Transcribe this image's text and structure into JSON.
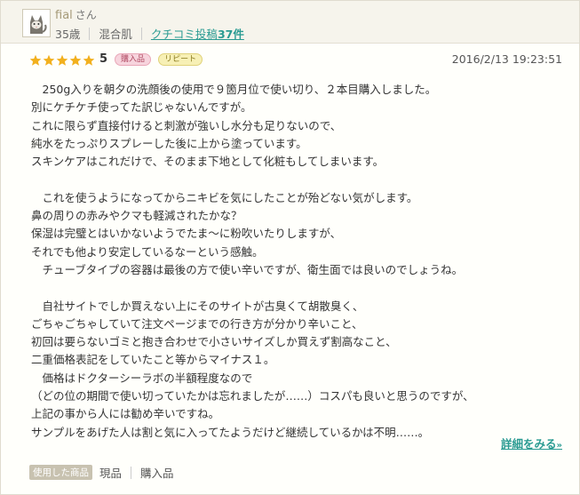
{
  "user": {
    "name": "fial",
    "suffix": "さん",
    "age": "35歳",
    "skin_type": "混合肌",
    "posts_label": "クチコミ投稿",
    "posts_count": "37件"
  },
  "review": {
    "rating": 5,
    "badges": [
      "購入品",
      "リピート"
    ],
    "timestamp": "2016/2/13 19:23:51",
    "lines": [
      "　250g入りを朝夕の洗顔後の使用で９箇月位で使い切り、２本目購入しました。",
      "別にケチケチ使ってた訳じゃないんですが。",
      "これに限らず直接付けると刺激が強いし水分も足りないので、",
      "純水をたっぷりスプレーした後に上から塗っています。",
      "スキンケアはこれだけで、そのまま下地として化粧もしてしまいます。",
      "",
      "　これを使うようになってからニキビを気にしたことが殆どない気がします。",
      "鼻の周りの赤みやクマも軽減されたかな？",
      "保湿は完璧とはいかないようでたま～に粉吹いたりしますが、",
      "それでも他より安定しているなーという感触。",
      "　チューブタイプの容器は最後の方で使い辛いですが、衛生面では良いのでしょうね。",
      "",
      "　自社サイトでしか買えない上にそのサイトが古臭くて胡散臭く、",
      "ごちゃごちゃしていて注文ページまでの行き方が分かり辛いこと、",
      "初回は要らないゴミと抱き合わせで小さいサイズしか買えず割高なこと、",
      "二重価格表記をしていたこと等からマイナス１。",
      "　価格はドクターシーラボの半額程度なので",
      "（どの位の期間で使い切っていたかは忘れましたが……）コスパも良いと思うのですが、",
      "上記の事から人には勧め辛いですね。",
      "サンプルをあげた人は割と気に入ってたようだけど継続しているかは不明……。"
    ],
    "more_label": "詳細をみる",
    "more_chevron": "»"
  },
  "footer": {
    "used_label": "使用した商品",
    "items": [
      "現品",
      "購入品"
    ]
  },
  "colors": {
    "star": "#f2b01e",
    "link": "#2a9b92",
    "header_bg": "#f6f4ec"
  },
  "icons": {
    "avatar": "cat-avatar-icon",
    "star": "star-icon",
    "more": "double-chevron-right-icon"
  }
}
